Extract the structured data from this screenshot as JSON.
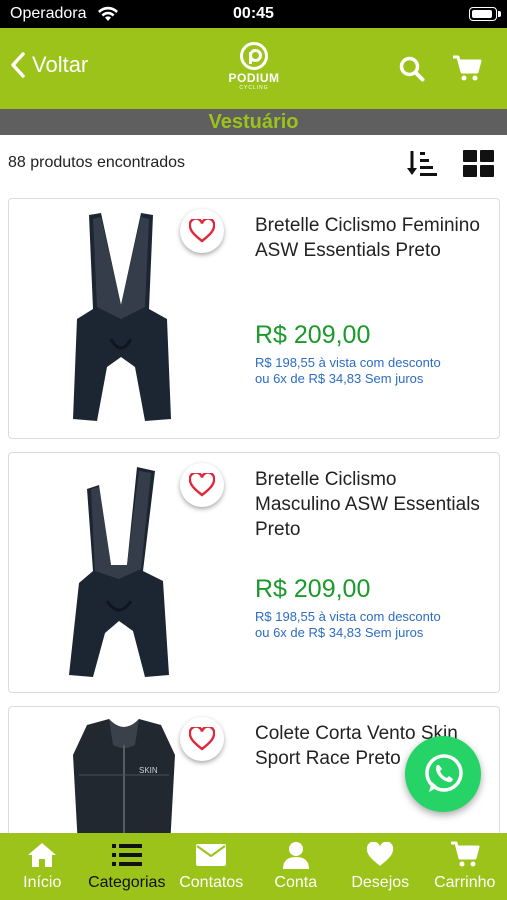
{
  "status_bar": {
    "carrier": "Operadora",
    "time": "00:45"
  },
  "navbar": {
    "back_label": "Voltar",
    "logo_name": "PODIUM",
    "logo_sub": "CYCLING"
  },
  "category": {
    "title": "Vestuário"
  },
  "results": {
    "count_text": "88 produtos encontrados"
  },
  "products": [
    {
      "title": "Bretelle Ciclismo Feminino ASW Essentials Preto",
      "price": "R$ 209,00",
      "installments_line1": "R$ 198,55 à vista com desconto",
      "installments_line2": "ou 6x de R$ 34,83 Sem juros"
    },
    {
      "title": "Bretelle Ciclismo Masculino ASW Essentials Preto",
      "price": "R$ 209,00",
      "installments_line1": "R$ 198,55 à vista com desconto",
      "installments_line2": "ou 6x de R$ 34,83 Sem juros"
    },
    {
      "title": "Colete Corta Vento Skin Sport Race Preto",
      "price": "",
      "installments_line1": "",
      "installments_line2": "",
      "image_text": "SKIN"
    }
  ],
  "tabs": [
    {
      "label": "Início",
      "icon": "home-icon"
    },
    {
      "label": "Categorias",
      "icon": "list-icon"
    },
    {
      "label": "Contatos",
      "icon": "envelope-icon"
    },
    {
      "label": "Conta",
      "icon": "user-icon"
    },
    {
      "label": "Desejos",
      "icon": "heart-icon"
    },
    {
      "label": "Carrinho",
      "icon": "cart-icon"
    }
  ],
  "colors": {
    "brand_green": "#9bc31a",
    "category_bar_bg": "#5f5f5f",
    "price_green": "#1a9a2a",
    "installments_blue": "#2b6cc4",
    "heart_red": "#e0283a",
    "whatsapp_green": "#25d366"
  }
}
